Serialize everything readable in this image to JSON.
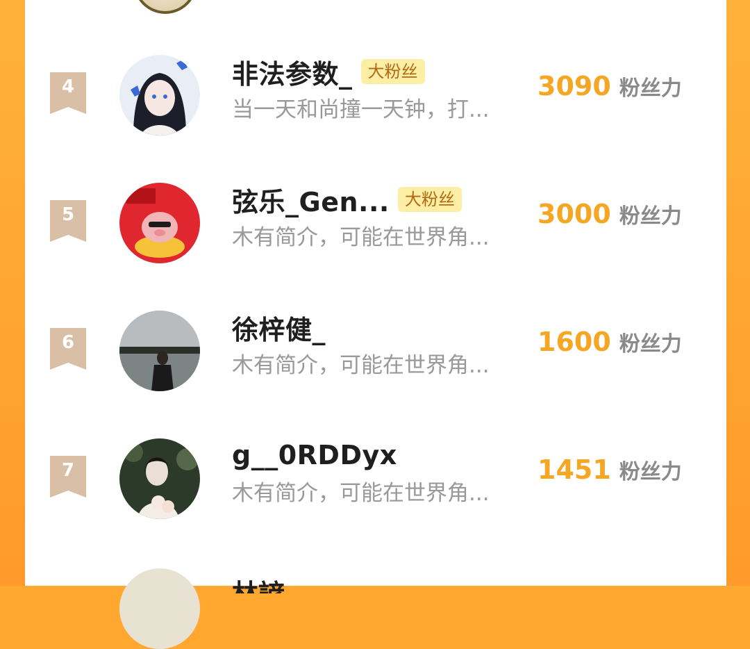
{
  "leaderboard": {
    "unit_label": "粉丝力",
    "tag_label": "大粉丝",
    "rows": [
      {
        "rank": "4",
        "name": "非法参数_",
        "tag": "大粉丝",
        "bio": "当一天和尚撞一天钟，打...",
        "score": "3090",
        "unit": "粉丝力"
      },
      {
        "rank": "5",
        "name": "弦乐_Gen...",
        "tag": "大粉丝",
        "bio": "木有简介，可能在世界角...",
        "score": "3000",
        "unit": "粉丝力"
      },
      {
        "rank": "6",
        "name": "徐梓健_",
        "tag": "",
        "bio": "木有简介，可能在世界角...",
        "score": "1600",
        "unit": "粉丝力"
      },
      {
        "rank": "7",
        "name": "g__0RDDyx",
        "tag": "",
        "bio": "木有简介，可能在世界角...",
        "score": "1451",
        "unit": "粉丝力"
      }
    ],
    "partial_next": {
      "name": "林諺"
    }
  },
  "colors": {
    "frame": "#ffa72e",
    "score": "#f5a623",
    "tag_bg": "#fdeea6",
    "tag_text": "#b06a12",
    "badge": "#d9bfa6"
  },
  "icons": {
    "rank_badge": "ribbon-badge-icon"
  }
}
